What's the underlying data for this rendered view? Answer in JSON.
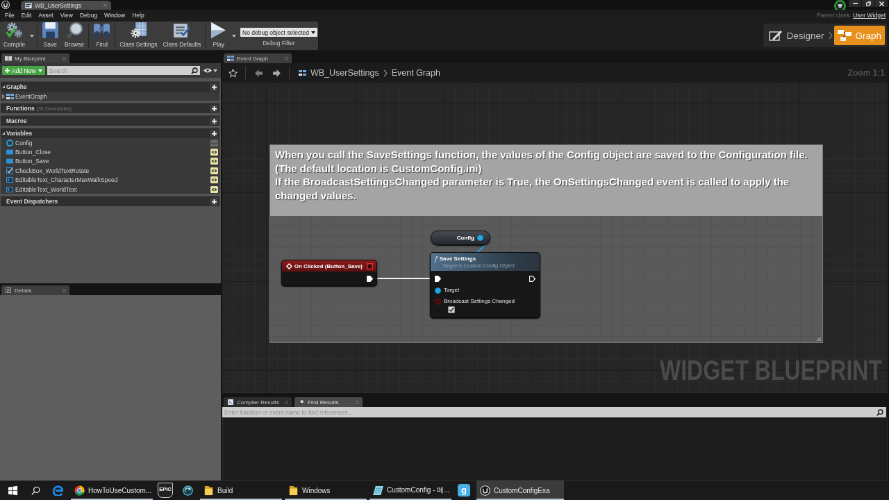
{
  "title_bar": {
    "tab": "WB_UserSettings"
  },
  "menu": {
    "items": [
      "File",
      "Edit",
      "Asset",
      "View",
      "Debug",
      "Window",
      "Help"
    ],
    "parent_class_label": "Parent class:",
    "parent_class": "User Widget"
  },
  "toolbar": {
    "buttons": [
      {
        "kind": "compile",
        "label": "Compile",
        "dropdown": true
      },
      {
        "kind": "save",
        "label": "Save",
        "dropdown": false
      },
      {
        "kind": "browse",
        "label": "Browse",
        "dropdown": false
      },
      {
        "kind": "find",
        "label": "Find",
        "dropdown": false
      },
      {
        "kind": "class_settings",
        "label": "Class Settings",
        "dropdown": false
      },
      {
        "kind": "class_defaults",
        "label": "Class Defaults",
        "dropdown": false
      },
      {
        "kind": "play",
        "label": "Play",
        "dropdown": true
      }
    ],
    "debug_filter": {
      "value": "No debug object selected",
      "label": "Debug Filter"
    }
  },
  "modes": [
    {
      "kind": "designer",
      "label": "Designer",
      "selected": false
    },
    {
      "kind": "graph",
      "label": "Graph",
      "selected": true
    }
  ],
  "my_blueprint": {
    "tab": "My Blueprint",
    "add_new": "Add New",
    "search": {
      "placeholder": "Search"
    },
    "sections": [
      {
        "title": "Graphs",
        "expanded": true,
        "items": [
          {
            "kind": "graph",
            "name": "EventGraph",
            "expanded": false
          }
        ]
      },
      {
        "title": "Functions",
        "note": "(35 Overridable)",
        "expanded": false
      },
      {
        "title": "Macros",
        "expanded": false
      },
      {
        "title": "Variables",
        "expanded": true,
        "items": [
          {
            "kind": "object",
            "name": "Config",
            "exposed": false
          },
          {
            "kind": "button",
            "name": "Button_Close",
            "exposed": true
          },
          {
            "kind": "button",
            "name": "Button_Save",
            "exposed": true
          },
          {
            "kind": "checkbox",
            "name": "CheckBox_WorldTextRotate",
            "exposed": true
          },
          {
            "kind": "editable_text",
            "name": "EditableText_CharacterMaxWalkSpeed",
            "exposed": true
          },
          {
            "kind": "editable_text",
            "name": "EditableText_WorldText",
            "exposed": true
          }
        ]
      },
      {
        "title": "Event Dispatchers",
        "expanded": false
      }
    ]
  },
  "details": {
    "tab": "Details"
  },
  "graph": {
    "tab": "Event Graph",
    "breadcrumb": [
      "WB_UserSettings",
      "Event Graph"
    ],
    "zoom": "Zoom 1:1",
    "watermark": "WIDGET BLUEPRINT",
    "comment": {
      "lines": [
        "When you call the SaveSettings function, the values of the Config object are saved to the Configuration file.",
        "(The default location is CustomConfig.ini)",
        "If the BroadcastSettingsChanged parameter is True, the OnSettingsChanged event is called to apply the changed values."
      ]
    },
    "nodes": [
      {
        "kind": "event",
        "title": "On Clicked (Button_Save)",
        "pins": [
          {
            "kind": "delegate",
            "connected": false
          },
          {
            "kind": "exec_out",
            "connected": true
          }
        ]
      },
      {
        "kind": "variable",
        "title": "Config",
        "pins": [
          {
            "kind": "object_out",
            "connected": true
          }
        ]
      },
      {
        "kind": "function",
        "glyph": "f",
        "title": "Save Settings",
        "subtitle": "Target is Custom Config Object",
        "pins": [
          {
            "kind": "exec_in",
            "connected": true
          },
          {
            "kind": "exec_out",
            "connected": false
          },
          {
            "kind": "object_in",
            "label": "Target",
            "connected": true
          },
          {
            "kind": "bool_in",
            "label": "Broadcast Settings Changed",
            "connected": false,
            "checked": true
          }
        ]
      }
    ],
    "wires": [
      {
        "kind": "exec"
      },
      {
        "kind": "object"
      }
    ]
  },
  "results": {
    "tabs": [
      {
        "kind": "log",
        "label": "Compiler Results",
        "selected": false
      },
      {
        "kind": "find",
        "label": "Find Results",
        "selected": true
      }
    ],
    "search": {
      "placeholder": "Enter function or event name to find references..."
    }
  },
  "taskbar": {
    "items": [
      {
        "kind": "start",
        "running": false,
        "active": false
      },
      {
        "kind": "search",
        "running": false,
        "active": false
      },
      {
        "kind": "edge",
        "running": false,
        "active": false
      },
      {
        "kind": "chrome",
        "label": "HowToUseCustom...",
        "running": true,
        "active": false
      },
      {
        "kind": "epic",
        "logo_text": "EPIC",
        "running": false,
        "active": false
      },
      {
        "kind": "sync",
        "running": false,
        "active": false
      },
      {
        "kind": "folder",
        "label": "Build",
        "running": true,
        "active": false
      },
      {
        "kind": "folder",
        "label": "Windows",
        "running": true,
        "active": false
      },
      {
        "kind": "notepad",
        "label": "CustomConfig - 메...",
        "running": true,
        "active": false
      },
      {
        "kind": "app",
        "logo_text": "g",
        "running": false,
        "active": false
      },
      {
        "kind": "unreal",
        "label": "CustomConfigExa",
        "running": true,
        "active": true
      }
    ]
  }
}
